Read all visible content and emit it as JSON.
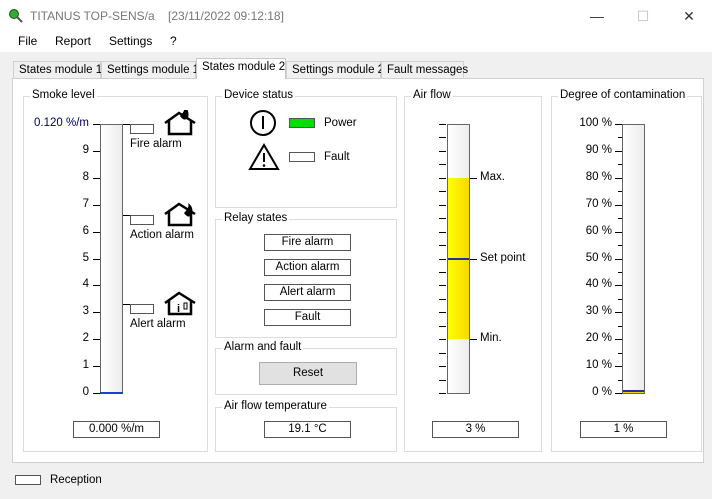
{
  "window": {
    "title": "TITANUS TOP-SENS/a",
    "timestamp": "[23/11/2022 09:12:18]",
    "minimize": "—",
    "maximize": "☐",
    "close": "✕"
  },
  "menu": [
    "File",
    "Report",
    "Settings",
    "?"
  ],
  "tabs": [
    {
      "label": "States module 1"
    },
    {
      "label": "Settings module 1"
    },
    {
      "label": "States module 2",
      "active": true
    },
    {
      "label": "Settings module 2"
    },
    {
      "label": "Fault messages"
    }
  ],
  "smoke": {
    "title": "Smoke level",
    "ticks": [
      "0.120 %/m",
      "9",
      "8",
      "7",
      "6",
      "5",
      "4",
      "3",
      "2",
      "1",
      "0"
    ],
    "alarms": [
      "Fire alarm",
      "Action alarm",
      "Alert alarm"
    ],
    "readout": "0.000 %/m",
    "level": 0
  },
  "device": {
    "title": "Device status",
    "power": "Power",
    "fault": "Fault",
    "power_color": "#00e000"
  },
  "relay": {
    "title": "Relay states",
    "items": [
      "Fire alarm",
      "Action alarm",
      "Alert alarm",
      "Fault"
    ]
  },
  "alarm_fault": {
    "title": "Alarm and fault",
    "reset": "Reset"
  },
  "temperature": {
    "title": "Air flow temperature",
    "value": "19.1 °C"
  },
  "airflow": {
    "title": "Air flow",
    "max": "Max.",
    "setpoint": "Set point",
    "min": "Min.",
    "readout": "3 %",
    "max_frac": 0.8,
    "setpoint_frac": 0.5,
    "min_frac": 0.2
  },
  "contamination": {
    "title": "Degree of contamination",
    "ticks": [
      "100 %",
      "90 %",
      "80 %",
      "70 %",
      "60 %",
      "50 %",
      "40 %",
      "30 %",
      "20 %",
      "10 %",
      "0 %"
    ],
    "readout": "1 %",
    "value": 1
  },
  "status": {
    "reception": "Reception"
  }
}
